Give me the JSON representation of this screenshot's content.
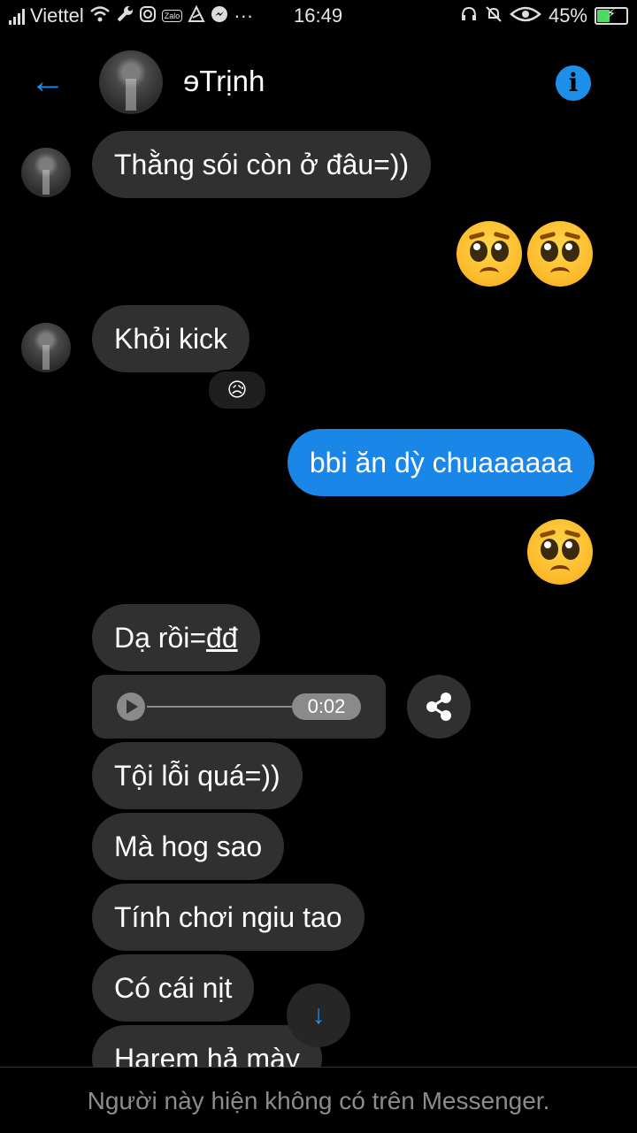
{
  "status_bar": {
    "carrier": "Viettel",
    "time": "16:49",
    "battery_percent": "45%",
    "battery_level": 0.45,
    "zalo_label": "Zalo",
    "more_label": "···"
  },
  "header": {
    "title": "ɘTrịnh",
    "back_icon": "←",
    "info_icon": "i"
  },
  "messages": {
    "m1": "Thằng sói còn ở đâu=))",
    "m2": "Khỏi kick",
    "m2_reaction": "😥",
    "m3": "bbi ăn dỳ chuaaaaaa",
    "m4_prefix": "Dạ rồi=",
    "m4_underlined": "đđ",
    "m5_audio_duration": "0:02",
    "m6": "Tội lỗi quá=))",
    "m7": "Mà hog sao",
    "m8": "Tính chơi ngiu tao",
    "m9": "Có cái nịt",
    "m10": "Harem hả mày"
  },
  "scroll_down_icon": "↓",
  "footer": {
    "notice": "Người này hiện không có trên Messenger."
  },
  "colors": {
    "accent": "#1a86e8",
    "bubble_incoming": "#303030",
    "background": "#000000"
  }
}
